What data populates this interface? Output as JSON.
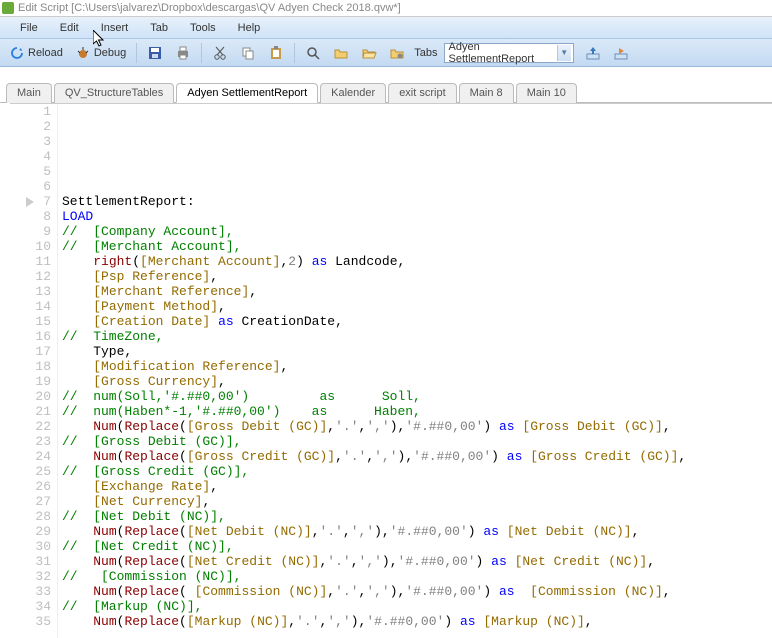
{
  "title": "Edit Script [C:\\Users\\jalvarez\\Dropbox\\descargas\\QV Adyen Check 2018.qvw*]",
  "menu": [
    "File",
    "Edit",
    "Insert",
    "Tab",
    "Tools",
    "Help"
  ],
  "toolbar": {
    "reload": "Reload",
    "debug": "Debug",
    "tabs_label": "Tabs",
    "tab_selected": "Adyen SettlementReport"
  },
  "tabs": [
    {
      "label": "Main",
      "active": false
    },
    {
      "label": "QV_StructureTables",
      "active": false
    },
    {
      "label": "Adyen SettlementReport",
      "active": true
    },
    {
      "label": "Kalender",
      "active": false
    },
    {
      "label": "exit script",
      "active": false
    },
    {
      "label": "Main 8",
      "active": false
    },
    {
      "label": "Main 10",
      "active": false
    }
  ],
  "code": {
    "first_line": 1,
    "bookmark_line": 7,
    "lines": [
      {
        "tokens": []
      },
      {
        "tokens": []
      },
      {
        "tokens": []
      },
      {
        "tokens": []
      },
      {
        "tokens": []
      },
      {
        "tokens": []
      },
      {
        "tokens": [
          {
            "t": "t",
            "v": "SettlementReport:"
          }
        ]
      },
      {
        "tokens": [
          {
            "t": "kw",
            "v": "LOAD"
          }
        ]
      },
      {
        "tokens": [
          {
            "t": "c",
            "v": "//  [Company Account],"
          }
        ]
      },
      {
        "tokens": [
          {
            "t": "c",
            "v": "//  [Merchant Account],"
          }
        ]
      },
      {
        "tokens": [
          {
            "t": "t",
            "v": "    "
          },
          {
            "t": "fn",
            "v": "right"
          },
          {
            "t": "p",
            "v": "("
          },
          {
            "t": "fld",
            "v": "[Merchant Account]"
          },
          {
            "t": "p",
            "v": ","
          },
          {
            "t": "num",
            "v": "2"
          },
          {
            "t": "p",
            "v": ") "
          },
          {
            "t": "kw",
            "v": "as"
          },
          {
            "t": "t",
            "v": " Landcode"
          },
          {
            "t": "p",
            "v": ","
          }
        ]
      },
      {
        "tokens": [
          {
            "t": "t",
            "v": "    "
          },
          {
            "t": "fld",
            "v": "[Psp Reference]"
          },
          {
            "t": "p",
            "v": ","
          }
        ]
      },
      {
        "tokens": [
          {
            "t": "t",
            "v": "    "
          },
          {
            "t": "fld",
            "v": "[Merchant Reference]"
          },
          {
            "t": "p",
            "v": ","
          }
        ]
      },
      {
        "tokens": [
          {
            "t": "t",
            "v": "    "
          },
          {
            "t": "fld",
            "v": "[Payment Method]"
          },
          {
            "t": "p",
            "v": ","
          }
        ]
      },
      {
        "tokens": [
          {
            "t": "t",
            "v": "    "
          },
          {
            "t": "fld",
            "v": "[Creation Date]"
          },
          {
            "t": "t",
            "v": " "
          },
          {
            "t": "kw",
            "v": "as"
          },
          {
            "t": "t",
            "v": " CreationDate"
          },
          {
            "t": "p",
            "v": ","
          }
        ]
      },
      {
        "tokens": [
          {
            "t": "c",
            "v": "//  TimeZone,"
          }
        ]
      },
      {
        "tokens": [
          {
            "t": "t",
            "v": "    Type"
          },
          {
            "t": "p",
            "v": ","
          }
        ]
      },
      {
        "tokens": [
          {
            "t": "t",
            "v": "    "
          },
          {
            "t": "fld",
            "v": "[Modification Reference]"
          },
          {
            "t": "p",
            "v": ","
          }
        ]
      },
      {
        "tokens": [
          {
            "t": "t",
            "v": "    "
          },
          {
            "t": "fld",
            "v": "[Gross Currency]"
          },
          {
            "t": "p",
            "v": ","
          }
        ]
      },
      {
        "tokens": [
          {
            "t": "c",
            "v": "//  num(Soll,'#.##0,00')         as      Soll,"
          }
        ]
      },
      {
        "tokens": [
          {
            "t": "c",
            "v": "//  num(Haben*-1,'#.##0,00')    as      Haben,"
          }
        ]
      },
      {
        "tokens": [
          {
            "t": "t",
            "v": "    "
          },
          {
            "t": "fn",
            "v": "Num"
          },
          {
            "t": "p",
            "v": "("
          },
          {
            "t": "fn",
            "v": "Replace"
          },
          {
            "t": "p",
            "v": "("
          },
          {
            "t": "fld",
            "v": "[Gross Debit (GC)]"
          },
          {
            "t": "p",
            "v": ","
          },
          {
            "t": "str",
            "v": "'.'"
          },
          {
            "t": "p",
            "v": ","
          },
          {
            "t": "str",
            "v": "','"
          },
          {
            "t": "p",
            "v": "),"
          },
          {
            "t": "str",
            "v": "'#.##0,00'"
          },
          {
            "t": "p",
            "v": ") "
          },
          {
            "t": "kw",
            "v": "as"
          },
          {
            "t": "t",
            "v": " "
          },
          {
            "t": "fld",
            "v": "[Gross Debit (GC)]"
          },
          {
            "t": "p",
            "v": ","
          }
        ]
      },
      {
        "tokens": [
          {
            "t": "c",
            "v": "//  [Gross Debit (GC)],"
          }
        ]
      },
      {
        "tokens": [
          {
            "t": "t",
            "v": "    "
          },
          {
            "t": "fn",
            "v": "Num"
          },
          {
            "t": "p",
            "v": "("
          },
          {
            "t": "fn",
            "v": "Replace"
          },
          {
            "t": "p",
            "v": "("
          },
          {
            "t": "fld",
            "v": "[Gross Credit (GC)]"
          },
          {
            "t": "p",
            "v": ","
          },
          {
            "t": "str",
            "v": "'.'"
          },
          {
            "t": "p",
            "v": ","
          },
          {
            "t": "str",
            "v": "','"
          },
          {
            "t": "p",
            "v": "),"
          },
          {
            "t": "str",
            "v": "'#.##0,00'"
          },
          {
            "t": "p",
            "v": ") "
          },
          {
            "t": "kw",
            "v": "as"
          },
          {
            "t": "t",
            "v": " "
          },
          {
            "t": "fld",
            "v": "[Gross Credit (GC)]"
          },
          {
            "t": "p",
            "v": ","
          }
        ]
      },
      {
        "tokens": [
          {
            "t": "c",
            "v": "//  [Gross Credit (GC)],"
          }
        ]
      },
      {
        "tokens": [
          {
            "t": "t",
            "v": "    "
          },
          {
            "t": "fld",
            "v": "[Exchange Rate]"
          },
          {
            "t": "p",
            "v": ","
          }
        ]
      },
      {
        "tokens": [
          {
            "t": "t",
            "v": "    "
          },
          {
            "t": "fld",
            "v": "[Net Currency]"
          },
          {
            "t": "p",
            "v": ","
          }
        ]
      },
      {
        "tokens": [
          {
            "t": "c",
            "v": "//  [Net Debit (NC)],"
          }
        ]
      },
      {
        "tokens": [
          {
            "t": "t",
            "v": "    "
          },
          {
            "t": "fn",
            "v": "Num"
          },
          {
            "t": "p",
            "v": "("
          },
          {
            "t": "fn",
            "v": "Replace"
          },
          {
            "t": "p",
            "v": "("
          },
          {
            "t": "fld",
            "v": "[Net Debit (NC)]"
          },
          {
            "t": "p",
            "v": ","
          },
          {
            "t": "str",
            "v": "'.'"
          },
          {
            "t": "p",
            "v": ","
          },
          {
            "t": "str",
            "v": "','"
          },
          {
            "t": "p",
            "v": "),"
          },
          {
            "t": "str",
            "v": "'#.##0,00'"
          },
          {
            "t": "p",
            "v": ") "
          },
          {
            "t": "kw",
            "v": "as"
          },
          {
            "t": "t",
            "v": " "
          },
          {
            "t": "fld",
            "v": "[Net Debit (NC)]"
          },
          {
            "t": "p",
            "v": ","
          }
        ]
      },
      {
        "tokens": [
          {
            "t": "c",
            "v": "//  [Net Credit (NC)],"
          }
        ]
      },
      {
        "tokens": [
          {
            "t": "t",
            "v": "    "
          },
          {
            "t": "fn",
            "v": "Num"
          },
          {
            "t": "p",
            "v": "("
          },
          {
            "t": "fn",
            "v": "Replace"
          },
          {
            "t": "p",
            "v": "("
          },
          {
            "t": "fld",
            "v": "[Net Credit (NC)]"
          },
          {
            "t": "p",
            "v": ","
          },
          {
            "t": "str",
            "v": "'.'"
          },
          {
            "t": "p",
            "v": ","
          },
          {
            "t": "str",
            "v": "','"
          },
          {
            "t": "p",
            "v": "),"
          },
          {
            "t": "str",
            "v": "'#.##0,00'"
          },
          {
            "t": "p",
            "v": ") "
          },
          {
            "t": "kw",
            "v": "as"
          },
          {
            "t": "t",
            "v": " "
          },
          {
            "t": "fld",
            "v": "[Net Credit (NC)]"
          },
          {
            "t": "p",
            "v": ","
          }
        ]
      },
      {
        "tokens": [
          {
            "t": "c",
            "v": "//   [Commission (NC)],"
          }
        ]
      },
      {
        "tokens": [
          {
            "t": "t",
            "v": "    "
          },
          {
            "t": "fn",
            "v": "Num"
          },
          {
            "t": "p",
            "v": "("
          },
          {
            "t": "fn",
            "v": "Replace"
          },
          {
            "t": "p",
            "v": "( "
          },
          {
            "t": "fld",
            "v": "[Commission (NC)]"
          },
          {
            "t": "p",
            "v": ","
          },
          {
            "t": "str",
            "v": "'.'"
          },
          {
            "t": "p",
            "v": ","
          },
          {
            "t": "str",
            "v": "','"
          },
          {
            "t": "p",
            "v": "),"
          },
          {
            "t": "str",
            "v": "'#.##0,00'"
          },
          {
            "t": "p",
            "v": ") "
          },
          {
            "t": "kw",
            "v": "as"
          },
          {
            "t": "t",
            "v": "  "
          },
          {
            "t": "fld",
            "v": "[Commission (NC)]"
          },
          {
            "t": "p",
            "v": ","
          }
        ]
      },
      {
        "tokens": [
          {
            "t": "c",
            "v": "//  [Markup (NC)],"
          }
        ]
      },
      {
        "tokens": [
          {
            "t": "t",
            "v": "    "
          },
          {
            "t": "fn",
            "v": "Num"
          },
          {
            "t": "p",
            "v": "("
          },
          {
            "t": "fn",
            "v": "Replace"
          },
          {
            "t": "p",
            "v": "("
          },
          {
            "t": "fld",
            "v": "[Markup (NC)]"
          },
          {
            "t": "p",
            "v": ","
          },
          {
            "t": "str",
            "v": "'.'"
          },
          {
            "t": "p",
            "v": ","
          },
          {
            "t": "str",
            "v": "','"
          },
          {
            "t": "p",
            "v": "),"
          },
          {
            "t": "str",
            "v": "'#.##0,00'"
          },
          {
            "t": "p",
            "v": ") "
          },
          {
            "t": "kw",
            "v": "as"
          },
          {
            "t": "t",
            "v": " "
          },
          {
            "t": "fld",
            "v": "[Markup (NC)]"
          },
          {
            "t": "p",
            "v": ","
          }
        ]
      }
    ]
  }
}
